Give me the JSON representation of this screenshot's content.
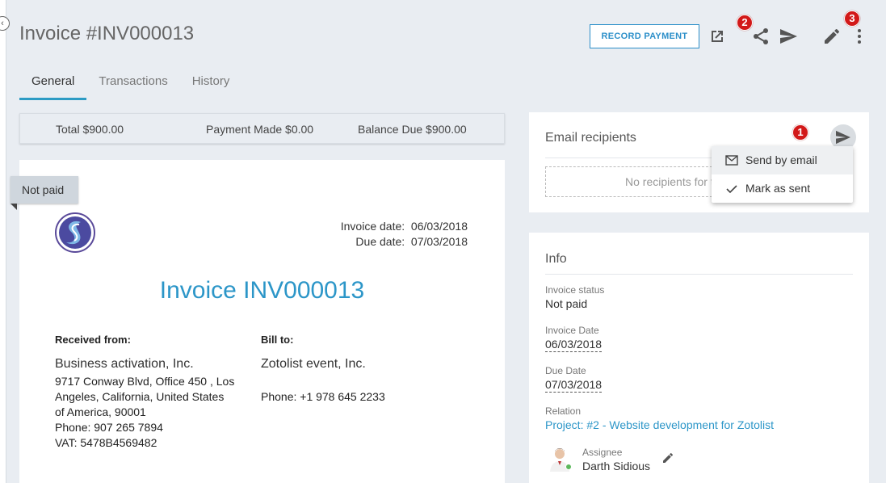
{
  "header": {
    "title": "Invoice #INV000013",
    "record_payment_label": "RECORD PAYMENT",
    "badge_share": "2",
    "badge_more": "3"
  },
  "tabs": [
    {
      "label": "General",
      "active": true
    },
    {
      "label": "Transactions",
      "active": false
    },
    {
      "label": "History",
      "active": false
    }
  ],
  "totals": {
    "total": "Total $900.00",
    "payment_made": "Payment Made $0.00",
    "balance_due": "Balance Due $900.00"
  },
  "invoice": {
    "status_ribbon": "Not paid",
    "invoice_date_label": "Invoice date:",
    "invoice_date": "06/03/2018",
    "due_date_label": "Due date:",
    "due_date": "07/03/2018",
    "heading": "Invoice INV000013",
    "received_from": {
      "title": "Received from:",
      "company": "Business activation, Inc.",
      "address_lines": [
        "9717 Conway Blvd, Office 450 , Los",
        "Angeles, California, United States",
        "of America, 90001"
      ],
      "phone": "Phone: 907 265 7894",
      "vat": "VAT: 5478B4569482"
    },
    "bill_to": {
      "title": "Bill to:",
      "company": "Zotolist event, Inc.",
      "phone": "Phone: +1 978 645 2233"
    }
  },
  "email_card": {
    "title": "Email recipients",
    "empty_text": "No recipients for this invoice",
    "badge": "1"
  },
  "send_menu": {
    "items": [
      {
        "label": "Send by email",
        "icon": "envelope-icon"
      },
      {
        "label": "Mark as sent",
        "icon": "check-icon"
      }
    ]
  },
  "info_card": {
    "title": "Info",
    "invoice_status_label": "Invoice status",
    "invoice_status": "Not paid",
    "invoice_date_label": "Invoice Date",
    "invoice_date": "06/03/2018",
    "due_date_label": "Due Date",
    "due_date": "07/03/2018",
    "relation_label": "Relation",
    "relation": "Project: #2 - Website development for Zotolist",
    "assignee_label": "Assignee",
    "assignee": "Darth Sidious"
  },
  "colors": {
    "accent": "#2c96c8",
    "badge": "#d21919",
    "background": "#e9edf2"
  }
}
